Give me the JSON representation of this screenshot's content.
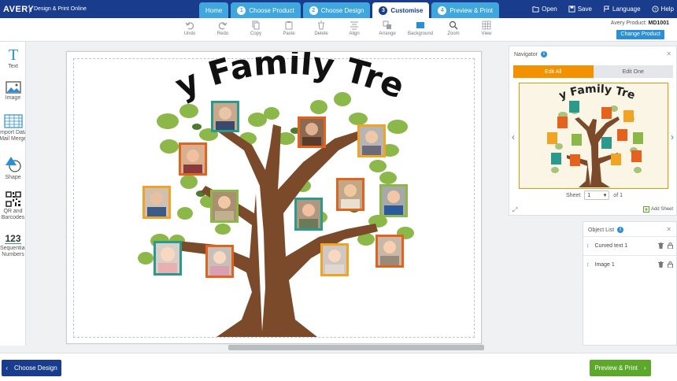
{
  "brand": {
    "logo": "AVERY",
    "tagline": "Design & Print Online"
  },
  "steps": [
    {
      "num": "",
      "label": "Home"
    },
    {
      "num": "1",
      "label": "Choose Product"
    },
    {
      "num": "2",
      "label": "Choose Design"
    },
    {
      "num": "3",
      "label": "Customise"
    },
    {
      "num": "4",
      "label": "Preview & Print"
    }
  ],
  "top_actions": {
    "open": "Open",
    "save": "Save",
    "language": "Language",
    "help": "Help"
  },
  "toolbar": {
    "undo": "Undo",
    "redo": "Redo",
    "copy": "Copy",
    "paste": "Paste",
    "delete": "Delete",
    "align": "Align",
    "arrange": "Arrange",
    "background": "Background",
    "zoom": "Zoom",
    "view": "View"
  },
  "product": {
    "label": "Avery Product:",
    "code": "MD1001",
    "change": "Change Product"
  },
  "sidebar": {
    "text": "Text",
    "image": "Image",
    "import_1": "Import Data",
    "import_2": "Mail Merge",
    "shape": "Shape",
    "qr_1": "QR and",
    "qr_2": "Barcodes",
    "seq_num": "123",
    "seq_1": "Sequential",
    "seq_2": "Numbers"
  },
  "design": {
    "title": "My Family Tree",
    "thumb_title": "My Family Tree"
  },
  "navigator": {
    "title": "Navigator",
    "edit_all": "Edit All",
    "edit_one": "Edit One",
    "sheet_label": "Sheet",
    "sheet_value": "1",
    "sheet_of": "of 1",
    "add_sheet": "Add Sheet"
  },
  "object_list": {
    "title": "Object List",
    "items": [
      {
        "label": "Curved text 1"
      },
      {
        "label": "Image 1"
      }
    ]
  },
  "bottom": {
    "back": "Choose Design",
    "next": "Preview & Print"
  },
  "colors": {
    "navy": "#1a3c8c",
    "blue": "#3fa6de",
    "orange": "#f39200",
    "green": "#5ba82a",
    "trunk": "#7a4a2a",
    "leaf": "#8cb84a"
  }
}
